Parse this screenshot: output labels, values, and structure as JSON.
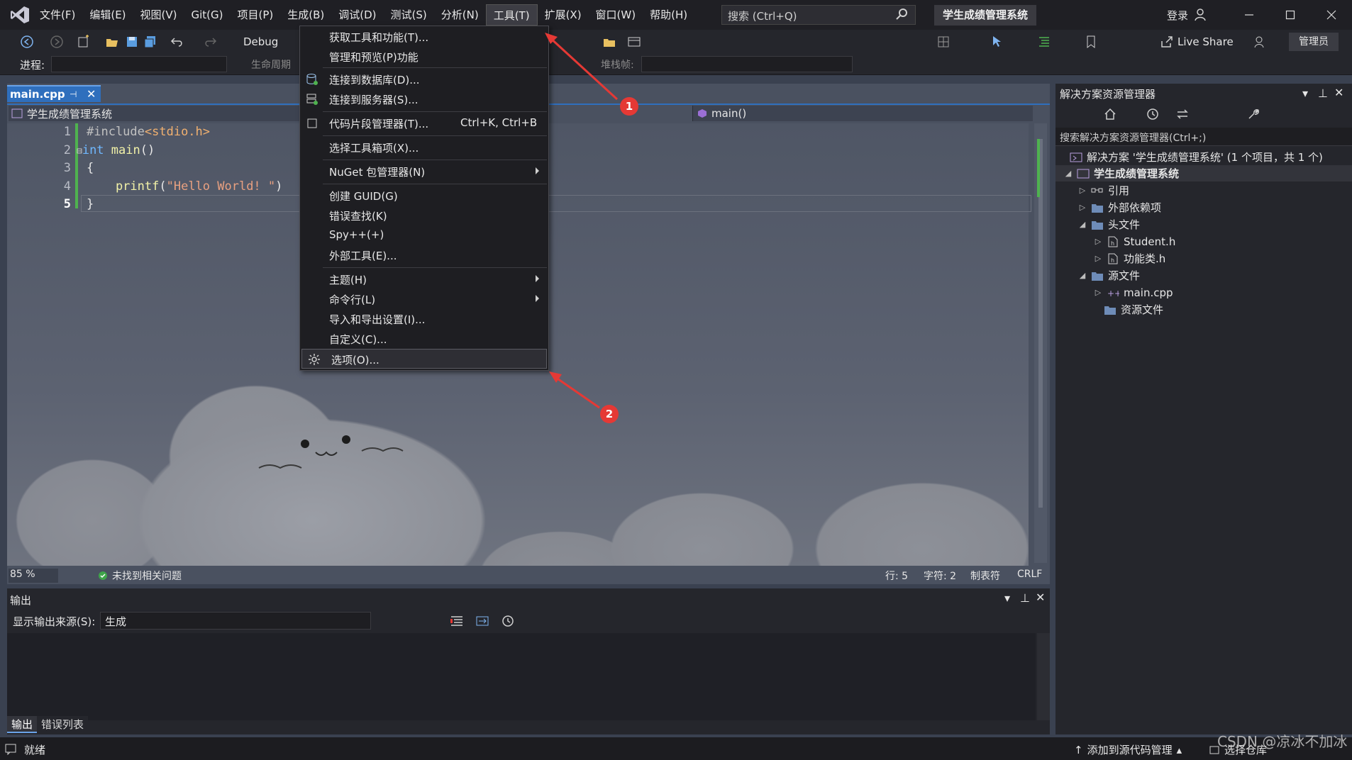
{
  "app": {
    "menu": [
      "文件(F)",
      "编辑(E)",
      "视图(V)",
      "Git(G)",
      "项目(P)",
      "生成(B)",
      "调试(D)",
      "测试(S)",
      "分析(N)",
      "工具(T)",
      "扩展(X)",
      "窗口(W)",
      "帮助(H)"
    ],
    "search_placeholder": "搜索 (Ctrl+Q)",
    "solution_title": "学生成绩管理系统",
    "login": "登录",
    "accent_color": "#2f6fbd",
    "annotation_color": "#e53935"
  },
  "toolbar": {
    "config": "Debug",
    "live_share": "Live Share",
    "admin": "管理员",
    "process_label": "进程:",
    "lifecycle_label": "生命周期",
    "stackframe_label": "堆栈帧:"
  },
  "editor": {
    "tab_name": "main.cpp",
    "nav_project": "学生成绩管理系统",
    "nav_member": "main()",
    "line_numbers": [
      "1",
      "2",
      "3",
      "4",
      "5"
    ],
    "code": {
      "l1_pp": "#include",
      "l1_inc": "<stdio.h>",
      "l2_fold": "⊟",
      "l2_kw": "int",
      "l2_fn": " main",
      "l2_rest": "()",
      "l3": "{",
      "l4_fn": "    printf",
      "l4_rest": "(",
      "l4_str": "\"Hello World! \"",
      "l4_end": ")",
      "l5": "}"
    },
    "zoom": "85 %",
    "issues": "未找到相关问题",
    "line": "行: 5",
    "char": "字符: 2",
    "tabs": "制表符",
    "eol": "CRLF"
  },
  "tools_menu": {
    "items": [
      {
        "label": "获取工具和功能(T)..."
      },
      {
        "label": "管理和预览(P)功能"
      },
      {
        "label": "连接到数据库(D)..."
      },
      {
        "label": "连接到服务器(S)..."
      },
      {
        "label": "代码片段管理器(T)...",
        "shortcut": "Ctrl+K, Ctrl+B"
      },
      {
        "label": "选择工具箱项(X)..."
      },
      {
        "label": "NuGet 包管理器(N)"
      },
      {
        "label": "创建 GUID(G)"
      },
      {
        "label": "错误查找(K)"
      },
      {
        "label": "Spy++(+)"
      },
      {
        "label": "外部工具(E)..."
      },
      {
        "label": "主题(H)"
      },
      {
        "label": "命令行(L)"
      },
      {
        "label": "导入和导出设置(I)..."
      },
      {
        "label": "自定义(C)..."
      },
      {
        "label": "选项(O)..."
      }
    ]
  },
  "annotations": [
    "1",
    "2"
  ],
  "solution_explorer": {
    "title": "解决方案资源管理器",
    "search": "搜索解决方案资源管理器(Ctrl+;)",
    "tree": [
      {
        "label": "解决方案 '学生成绩管理系统' (1 个项目，共 1 个)"
      },
      {
        "label": "学生成绩管理系统"
      },
      {
        "label": "引用"
      },
      {
        "label": "外部依赖项"
      },
      {
        "label": "头文件"
      },
      {
        "label": "Student.h"
      },
      {
        "label": "功能类.h"
      },
      {
        "label": "源文件"
      },
      {
        "label": "main.cpp"
      },
      {
        "label": "资源文件"
      }
    ]
  },
  "output": {
    "title": "输出",
    "source_label": "显示输出来源(S):",
    "source_value": "生成",
    "tabs": [
      "输出",
      "错误列表"
    ]
  },
  "status": {
    "ready": "就绪",
    "add_source": "添加到源代码管理",
    "select_repo": "选择仓库",
    "watermark": "CSDN @凉冰不加冰"
  }
}
